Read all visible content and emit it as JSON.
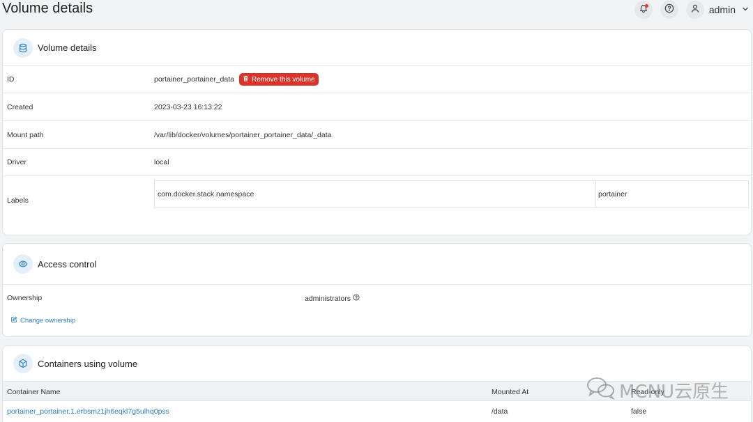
{
  "page": {
    "title": "Volume details"
  },
  "topbar": {
    "user": "admin"
  },
  "details": {
    "title": "Volume details",
    "id_label": "ID",
    "id_value": "portainer_portainer_data",
    "remove_label": "Remove this volume",
    "created_label": "Created",
    "created_value": "2023-03-23 16:13:22",
    "mount_label": "Mount path",
    "mount_value": "/var/lib/docker/volumes/portainer_portainer_data/_data",
    "driver_label": "Driver",
    "driver_value": "local",
    "labels_label": "Labels",
    "labels": [
      {
        "key": "com.docker.stack.namespace",
        "value": "portainer"
      }
    ]
  },
  "access": {
    "title": "Access control",
    "ownership_label": "Ownership",
    "ownership_value": "administrators",
    "change_label": "Change ownership"
  },
  "containers": {
    "title": "Containers using volume",
    "columns": [
      "Container Name",
      "Mounted At",
      "Read-only"
    ],
    "rows": [
      {
        "name": "portainer_portainer.1.erbsmz1jh6eqkl7g5ulhq0pss",
        "mounted_at": "/data",
        "read_only": "false"
      }
    ]
  },
  "watermark": {
    "text": "MCNU云原生"
  },
  "colors": {
    "accent": "#2a7ec6",
    "danger": "#d9342b",
    "icon_bg": "#e3f0fb"
  }
}
